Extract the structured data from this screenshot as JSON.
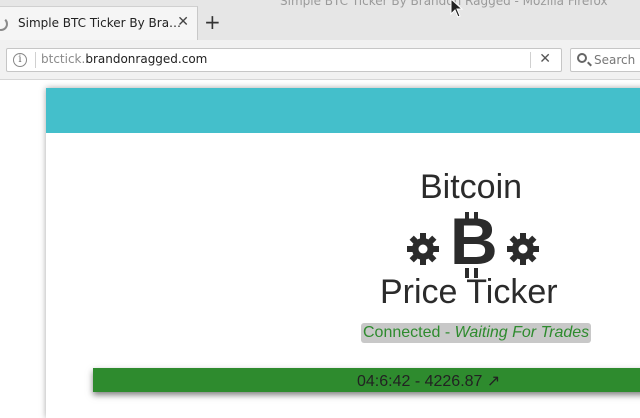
{
  "window": {
    "title": "Simple BTC Ticker By Brandon Ragged - Mozilla Firefox"
  },
  "tabs": [
    {
      "title": "Simple BTC Ticker By Bra…",
      "close": "✕"
    }
  ],
  "new_tab": "+",
  "url_bar": {
    "prefix": "btctick.",
    "domain": "brandonragged.com",
    "clear": "✕"
  },
  "search": {
    "placeholder": "Search"
  },
  "page": {
    "title_top": "Bitcoin",
    "symbol": "B",
    "title_bottom": "Price Ticker",
    "status": {
      "prefix": "Connected - ",
      "state": "Waiting For Trades"
    },
    "trade": "04:6:42 - 4226.87 ↗"
  },
  "colors": {
    "header": "#44bfcb",
    "trade_bar": "#2e8b2e",
    "status_text": "#2e8b2e",
    "status_bg": "#c8c8c8"
  }
}
